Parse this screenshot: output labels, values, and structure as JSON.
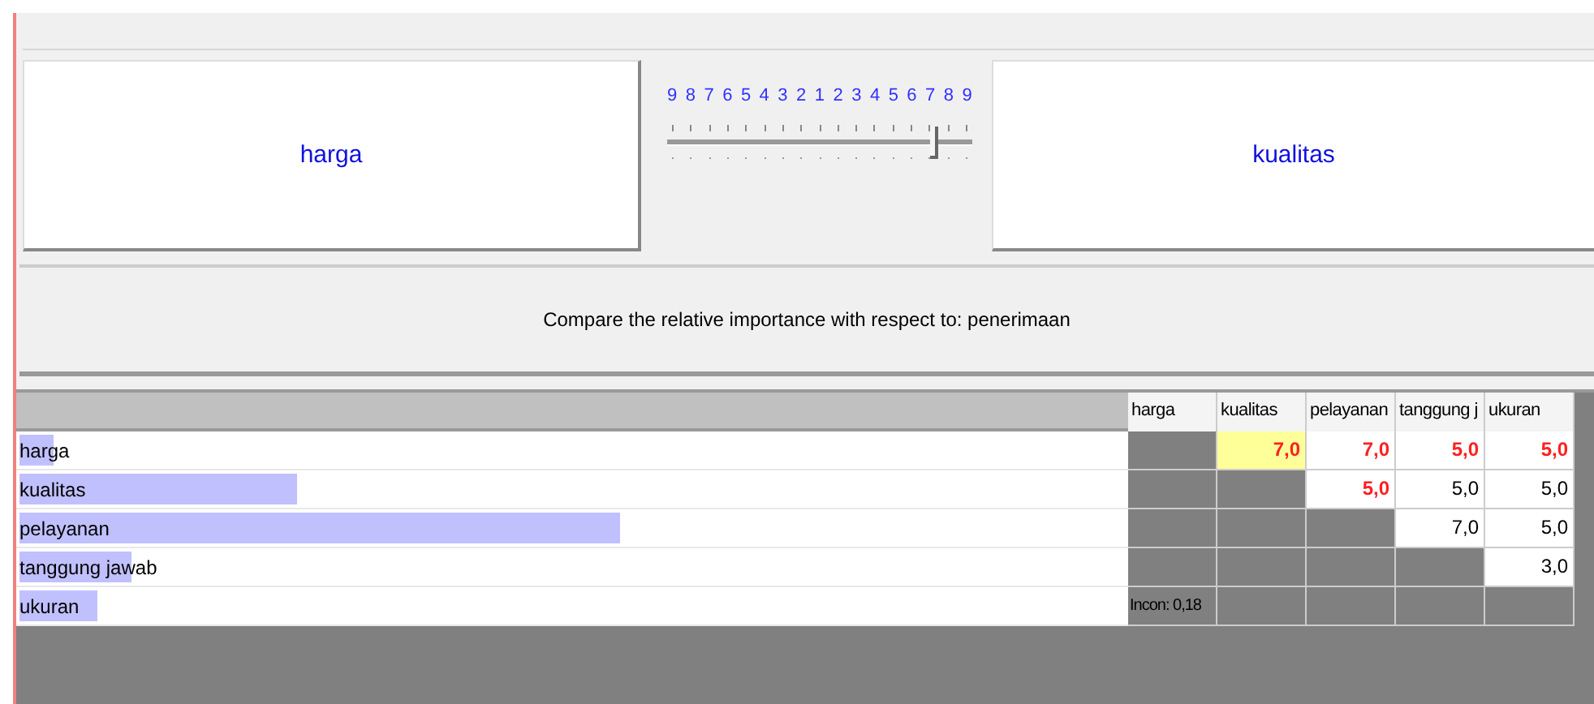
{
  "comparison": {
    "left": "harga",
    "right": "kualitas",
    "scale": [
      "9",
      "8",
      "7",
      "6",
      "5",
      "4",
      "3",
      "2",
      "1",
      "2",
      "3",
      "4",
      "5",
      "6",
      "7",
      "8",
      "9"
    ],
    "level": 0.875
  },
  "prompt": "Compare the relative importance with respect to: penerimaan",
  "matrix": {
    "columns": [
      "harga",
      "kualitas",
      "pelayanan",
      "tanggung j",
      "ukuran"
    ],
    "rows": [
      {
        "name": "harga",
        "level": 0.03,
        "cells": [
          {
            "kind": "blank"
          },
          {
            "kind": "value",
            "text": "7,0",
            "highlight": true,
            "selected": true
          },
          {
            "kind": "value",
            "text": "7,0",
            "highlight": true,
            "selected": false
          },
          {
            "kind": "value",
            "text": "5,0",
            "highlight": true,
            "selected": false
          },
          {
            "kind": "value",
            "text": "5,0",
            "highlight": true,
            "selected": false
          }
        ]
      },
      {
        "name": "kualitas",
        "level": 0.25,
        "cells": [
          {
            "kind": "blank"
          },
          {
            "kind": "blank"
          },
          {
            "kind": "value",
            "text": "5,0",
            "highlight": true,
            "selected": false
          },
          {
            "kind": "value",
            "text": "5,0",
            "highlight": false,
            "selected": false
          },
          {
            "kind": "value",
            "text": "5,0",
            "highlight": false,
            "selected": false
          }
        ]
      },
      {
        "name": "pelayanan",
        "level": 0.54,
        "cells": [
          {
            "kind": "blank"
          },
          {
            "kind": "blank"
          },
          {
            "kind": "blank"
          },
          {
            "kind": "value",
            "text": "7,0",
            "highlight": false,
            "selected": false
          },
          {
            "kind": "value",
            "text": "5,0",
            "highlight": false,
            "selected": false
          }
        ]
      },
      {
        "name": "tanggung jawab",
        "level": 0.1,
        "cells": [
          {
            "kind": "blank"
          },
          {
            "kind": "blank"
          },
          {
            "kind": "blank"
          },
          {
            "kind": "blank"
          },
          {
            "kind": "value",
            "text": "3,0",
            "highlight": false,
            "selected": false
          }
        ]
      },
      {
        "name": "ukuran",
        "level": 0.07,
        "cells": [
          {
            "kind": "label",
            "text": "Incon: 0,18"
          },
          {
            "kind": "blank"
          },
          {
            "kind": "blank"
          },
          {
            "kind": "blank"
          },
          {
            "kind": "blank"
          }
        ]
      }
    ]
  }
}
